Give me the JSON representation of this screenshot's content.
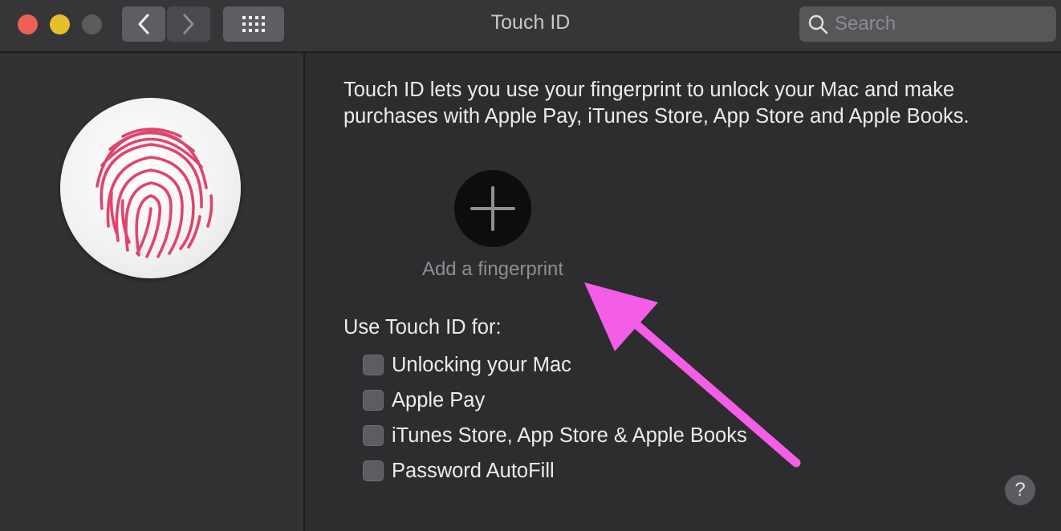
{
  "window": {
    "title": "Touch ID",
    "traffic_lights": {
      "close": "#ed5f56",
      "minimize": "#e6bf2d",
      "maximize": "#5b5a5d"
    }
  },
  "toolbar": {
    "back_icon": "chevron-left-icon",
    "forward_icon": "chevron-right-icon",
    "grid_icon": "grid-icon"
  },
  "search": {
    "placeholder": "Search",
    "value": ""
  },
  "sidebar": {
    "icon": "fingerprint-icon",
    "fingerprint_color": "#e0446c"
  },
  "main": {
    "description": "Touch ID lets you use your fingerprint to unlock your Mac and make purchases with Apple Pay, iTunes Store, App Store and Apple Books.",
    "add_fingerprint_label": "Add a fingerprint",
    "use_for_label": "Use Touch ID for:",
    "options": [
      {
        "label": "Unlocking your Mac",
        "checked": false
      },
      {
        "label": "Apple Pay",
        "checked": false
      },
      {
        "label": "iTunes Store, App Store & Apple Books",
        "checked": false
      },
      {
        "label": "Password AutoFill",
        "checked": false
      }
    ],
    "help_label": "?"
  },
  "annotation": {
    "arrow_color": "#f45ee6",
    "icon": "arrow-annotation-icon"
  }
}
